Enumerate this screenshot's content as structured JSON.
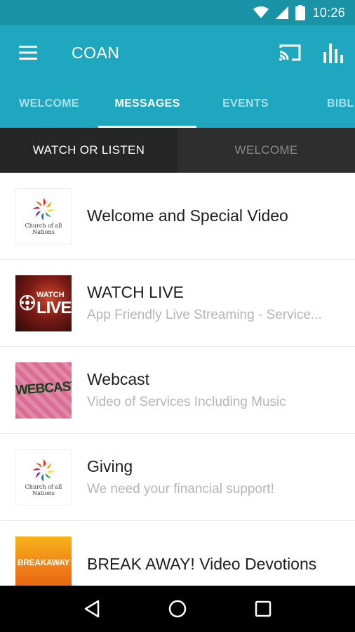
{
  "status_bar": {
    "time": "10:26",
    "icons": [
      "wifi-icon",
      "signal-icon",
      "battery-icon"
    ]
  },
  "app_bar": {
    "title": "COAN",
    "menu_icon": "hamburger-menu-icon",
    "actions": [
      "cast-icon",
      "bar-chart-icon"
    ]
  },
  "tabs": [
    {
      "label": "WELCOME",
      "active": false
    },
    {
      "label": "MESSAGES",
      "active": true
    },
    {
      "label": "EVENTS",
      "active": false
    },
    {
      "label": "BIBL",
      "active": false
    }
  ],
  "subtabs": [
    {
      "label": "WATCH OR LISTEN",
      "active": true
    },
    {
      "label": "WELCOME",
      "active": false
    }
  ],
  "list": [
    {
      "title": "Welcome and Special Video",
      "subtitle": "",
      "thumb": "coan",
      "thumb_text": "Church of all Nations"
    },
    {
      "title": "WATCH LIVE",
      "subtitle": "App Friendly Live Streaming - Service...",
      "thumb": "live",
      "thumb_text_1": "WATCH",
      "thumb_text_2": "LIVE"
    },
    {
      "title": "Webcast",
      "subtitle": "Video of Services Including Music",
      "thumb": "webcast",
      "thumb_text": "WEBCAST"
    },
    {
      "title": "Giving",
      "subtitle": "We need your financial support!",
      "thumb": "coan",
      "thumb_text": "Church of all Nations"
    },
    {
      "title": "BREAK AWAY!  Video Devotions",
      "subtitle": "",
      "thumb": "breakaway",
      "thumb_text": "BREAKAWAY"
    }
  ],
  "nav_bar": [
    "back-icon",
    "home-icon",
    "recents-icon"
  ],
  "colors": {
    "primary": "#1ea7bf",
    "status": "#1a93a7",
    "subtab_bg": "#2e2e2e"
  }
}
